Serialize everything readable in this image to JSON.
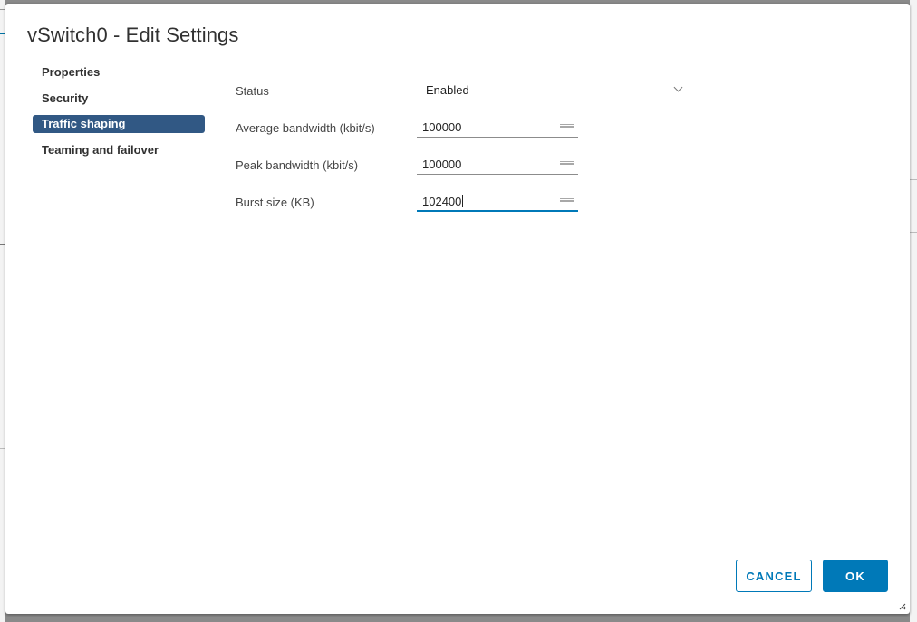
{
  "dialog": {
    "title": "vSwitch0 - Edit Settings"
  },
  "nav": {
    "items": [
      {
        "label": "Properties",
        "active": false
      },
      {
        "label": "Security",
        "active": false
      },
      {
        "label": "Traffic shaping",
        "active": true
      },
      {
        "label": "Teaming and failover",
        "active": false
      }
    ]
  },
  "form": {
    "status": {
      "label": "Status",
      "value": "Enabled"
    },
    "average_bandwidth": {
      "label": "Average bandwidth (kbit/s)",
      "value": "100000"
    },
    "peak_bandwidth": {
      "label": "Peak bandwidth (kbit/s)",
      "value": "100000"
    },
    "burst_size": {
      "label": "Burst size (KB)",
      "value": "102400"
    }
  },
  "footer": {
    "cancel_label": "CANCEL",
    "ok_label": "OK"
  },
  "colors": {
    "accent": "#0079b8",
    "nav_active_bg": "#315884",
    "title_text": "#313131"
  },
  "icons": {
    "select": "chevron-down-icon",
    "number_inputs": "spinner-icon",
    "dialog_corner": "resize-handle-icon"
  }
}
